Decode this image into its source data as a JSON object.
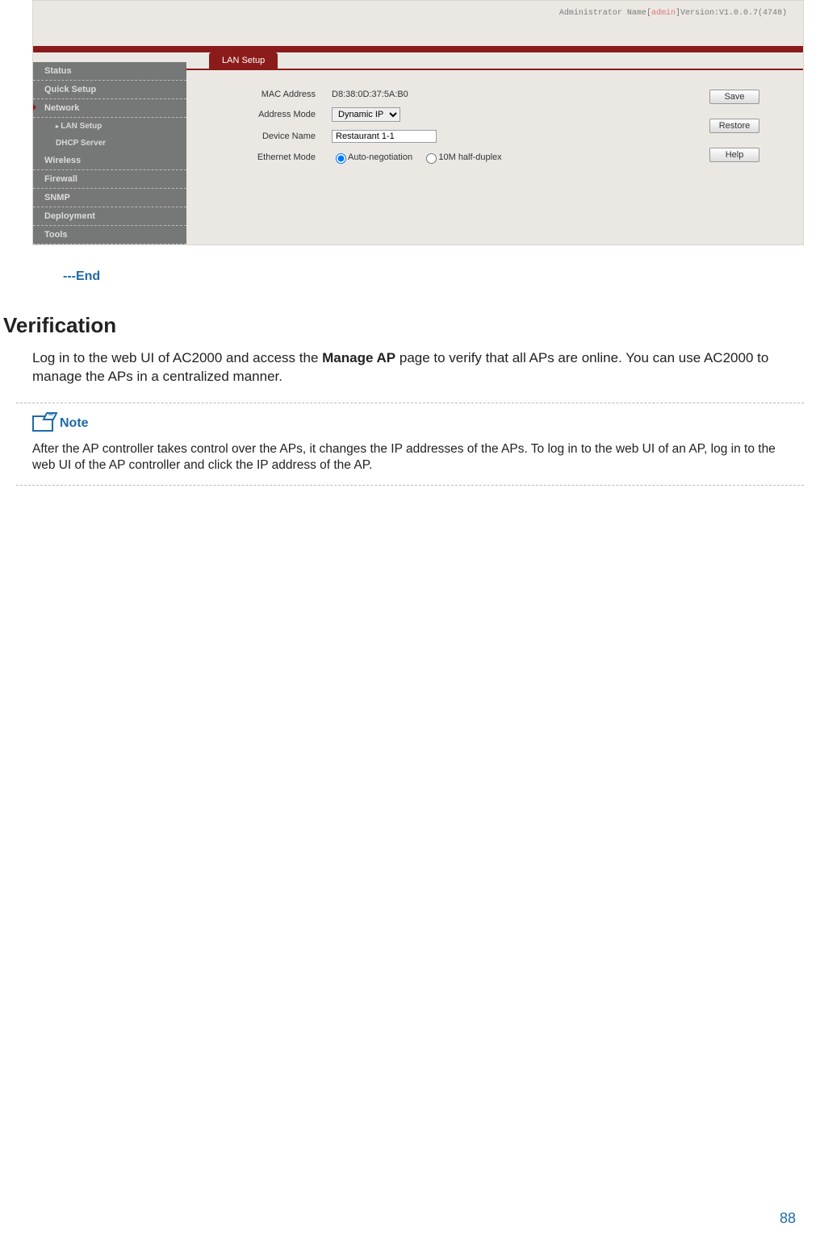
{
  "topbar": {
    "admin_prefix": "Administrator Name[",
    "admin_name": "admin",
    "admin_suffix": "]Version:V1.0.0.7(4748)"
  },
  "sidebar": {
    "items": [
      {
        "label": "Status"
      },
      {
        "label": "Quick Setup"
      },
      {
        "label": "Network"
      },
      {
        "label": "Wireless"
      },
      {
        "label": "Firewall"
      },
      {
        "label": "SNMP"
      },
      {
        "label": "Deployment"
      },
      {
        "label": "Tools"
      }
    ],
    "network_sub": [
      {
        "label": "LAN Setup",
        "active": true
      },
      {
        "label": "DHCP Server",
        "active": false
      }
    ]
  },
  "tab": {
    "label": "LAN Setup"
  },
  "form": {
    "mac_label": "MAC Address",
    "mac_value": "D8:38:0D:37:5A:B0",
    "mode_label": "Address Mode",
    "mode_value": "Dynamic IP",
    "devname_label": "Device Name",
    "devname_value": "Restaurant 1-1",
    "eth_label": "Ethernet Mode",
    "eth_opt1": "Auto-negotiation",
    "eth_opt2": "10M half-duplex"
  },
  "buttons": {
    "save": "Save",
    "restore": "Restore",
    "help": "Help"
  },
  "doc": {
    "end": "---End",
    "verification_h": "Verification",
    "verification_body_1a": "Log in to the web UI of AC2000 and access the ",
    "verification_body_1b": "Manage AP",
    "verification_body_1c": " page to verify that all APs are online. You can use AC2000 to manage the APs in a centralized manner.",
    "note_label": "Note",
    "note_text": "After the AP controller takes control over the APs, it changes the IP addresses of the APs. To log in to the web UI of an AP, log in to the web UI of the AP controller and click the IP address of the AP.",
    "page_num": "88"
  }
}
